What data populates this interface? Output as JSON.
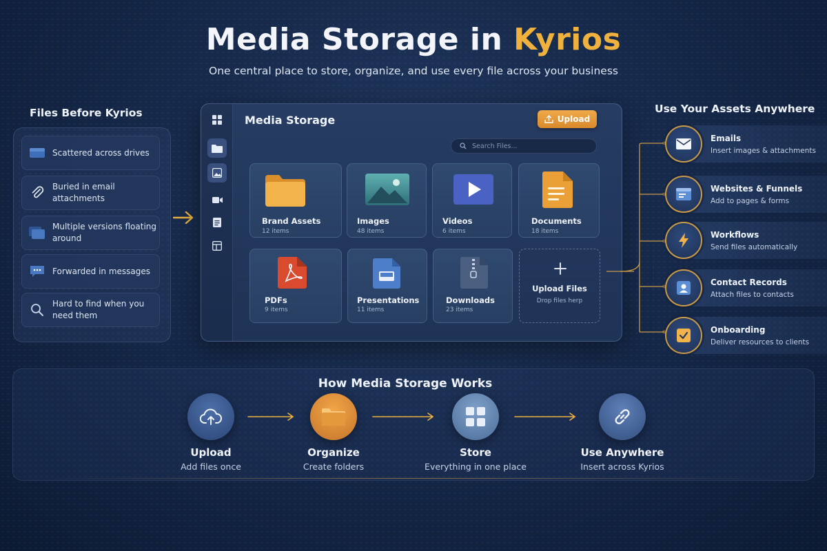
{
  "title": {
    "main": "Media Storage in",
    "accent": "Kyrios"
  },
  "subtitle": "One central place to store, organize, and use every file across your business",
  "colors": {
    "accent": "#efb23e",
    "upload_button": "#e29a38",
    "background": "#16294a"
  },
  "before": {
    "heading": "Files Before Kyrios",
    "items": [
      {
        "icon": "drive-icon",
        "label": "Scattered across drives"
      },
      {
        "icon": "paperclip-icon",
        "label": "Buried in email attachments"
      },
      {
        "icon": "folders-icon",
        "label": "Multiple versions floating around"
      },
      {
        "icon": "message-icon",
        "label": "Forwarded in messages"
      },
      {
        "icon": "search-icon",
        "label": "Hard to find when you need them"
      }
    ]
  },
  "window": {
    "title": "Media Storage",
    "upload_label": "Upload",
    "search_placeholder": "Search Files...",
    "sidebar_icons": [
      "grid-icon",
      "folder-icon",
      "image-icon",
      "video-icon",
      "document-icon",
      "layout-icon"
    ],
    "cards": [
      {
        "name": "Brand Assets",
        "count": "12 items",
        "icon": "folder-icon"
      },
      {
        "name": "Images",
        "count": "48 items",
        "icon": "image-icon"
      },
      {
        "name": "Videos",
        "count": "6 items",
        "icon": "video-icon"
      },
      {
        "name": "Documents",
        "count": "18 items",
        "icon": "document-icon"
      },
      {
        "name": "PDFs",
        "count": "9 items",
        "icon": "pdf-icon"
      },
      {
        "name": "Presentations",
        "count": "11 items",
        "icon": "presentation-icon"
      },
      {
        "name": "Downloads",
        "count": "23 items",
        "icon": "zip-icon"
      }
    ],
    "upload_card": {
      "title": "Upload Files",
      "hint": "Drop files herp"
    }
  },
  "anywhere": {
    "heading": "Use Your Assets Anywhere",
    "items": [
      {
        "icon": "mail-icon",
        "title": "Emails",
        "desc": "Insert images & attachments"
      },
      {
        "icon": "browser-icon",
        "title": "Websites & Funnels",
        "desc": "Add to pages & forms"
      },
      {
        "icon": "lightning-icon",
        "title": "Workflows",
        "desc": "Send files automatically"
      },
      {
        "icon": "contact-card-icon",
        "title": "Contact Records",
        "desc": "Attach files to contacts"
      },
      {
        "icon": "checkbox-icon",
        "title": "Onboarding",
        "desc": "Deliver resources to clients"
      }
    ]
  },
  "how": {
    "heading": "How Media Storage Works",
    "steps": [
      {
        "icon": "cloud-upload-icon",
        "title": "Upload",
        "desc": "Add files once"
      },
      {
        "icon": "folder-icon",
        "title": "Organize",
        "desc": "Create folders"
      },
      {
        "icon": "grid-icon",
        "title": "Store",
        "desc": "Everything in one place"
      },
      {
        "icon": "link-icon",
        "title": "Use Anywhere",
        "desc": "Insert across Kyrios"
      }
    ]
  }
}
